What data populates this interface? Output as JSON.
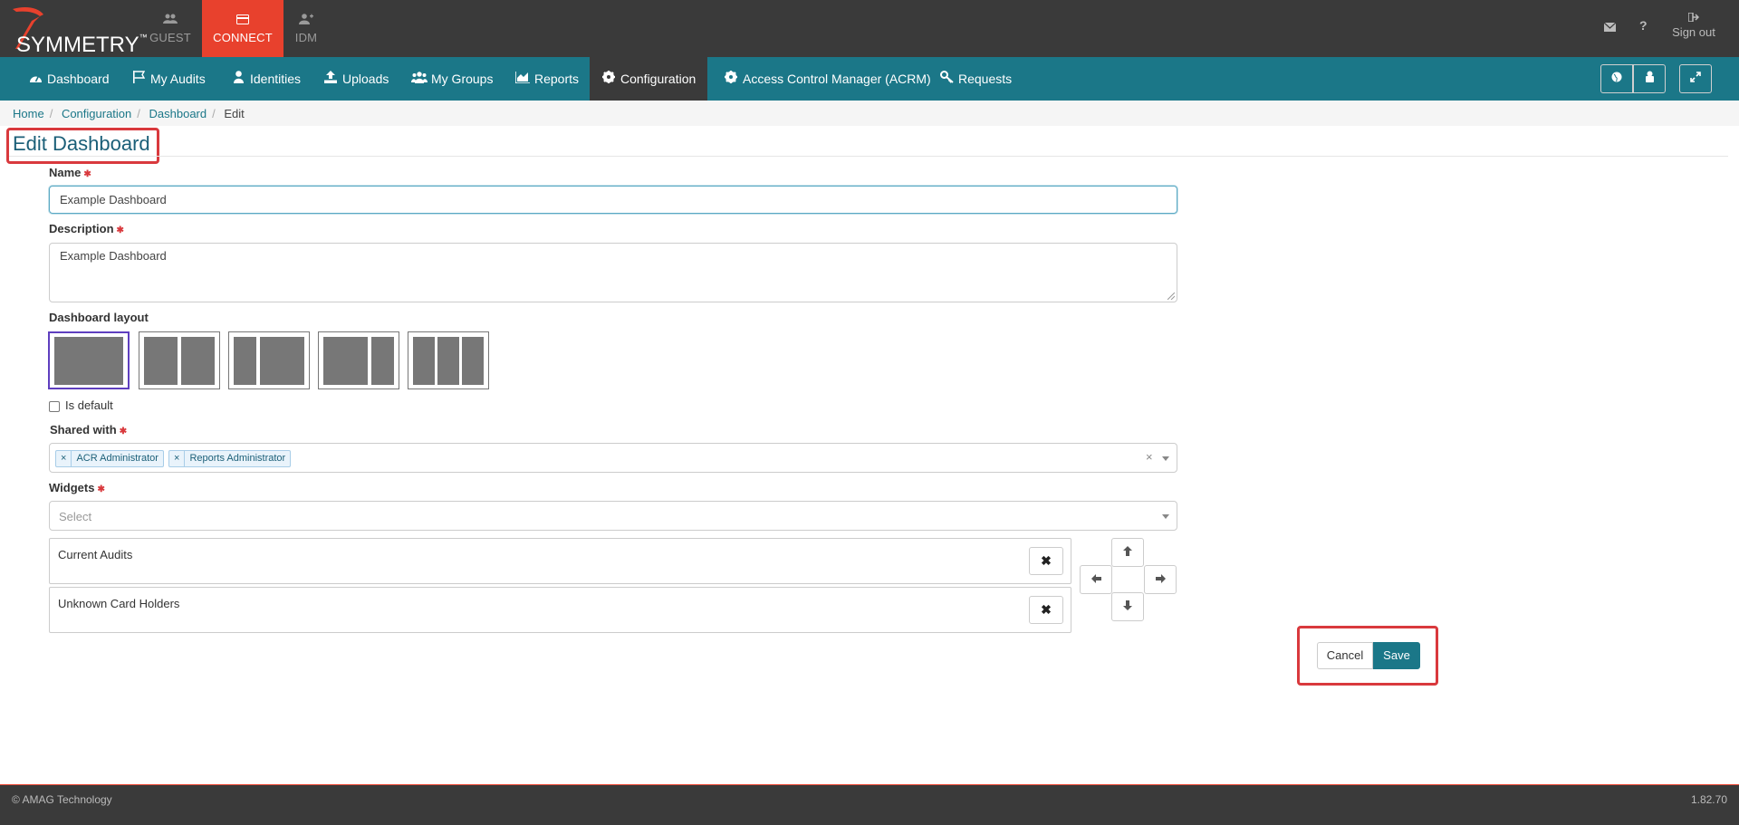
{
  "app": {
    "logo_text": "SYMMETRY",
    "logo_tm": "™",
    "tabs": [
      {
        "label": "GUEST",
        "icon": "users-icon"
      },
      {
        "label": "CONNECT",
        "icon": "card-icon"
      },
      {
        "label": "IDM",
        "icon": "user-plus-icon"
      }
    ],
    "top_right": {
      "mail_icon": "envelope-icon",
      "help_label": "?",
      "signout_label": "Sign out"
    }
  },
  "nav": {
    "items": [
      {
        "label": "Dashboard",
        "icon": "dashboard-icon"
      },
      {
        "label": "My Audits",
        "icon": "flag-icon"
      },
      {
        "label": "Identities",
        "icon": "user-icon"
      },
      {
        "label": "Uploads",
        "icon": "upload-icon"
      },
      {
        "label": "My Groups",
        "icon": "group-icon"
      },
      {
        "label": "Reports",
        "icon": "chart-icon"
      },
      {
        "label": "Configuration",
        "icon": "gear-icon"
      },
      {
        "label": "Access Control Manager (ACRM)",
        "icon": "gear-icon"
      },
      {
        "label": "Requests",
        "icon": "key-icon"
      }
    ],
    "right_buttons": [
      "globe-icon",
      "lock-icon",
      "expand-icon"
    ]
  },
  "breadcrumb": [
    "Home",
    "Configuration",
    "Dashboard",
    "Edit"
  ],
  "page_title": "Edit Dashboard",
  "form": {
    "name_label": "Name",
    "name_value": "Example Dashboard",
    "description_label": "Description",
    "description_value": "Example Dashboard",
    "layout_label": "Dashboard layout",
    "layouts_selected": 1,
    "is_default_label": "Is default",
    "is_default_checked": false,
    "shared_label": "Shared with",
    "shared_tags": [
      "ACR Administrator",
      "Reports Administrator"
    ],
    "widgets_label": "Widgets",
    "widgets_placeholder": "Select",
    "widgets": [
      "Current Audits",
      "Unknown Card Holders"
    ],
    "required_mark": "✱",
    "remove_glyph": "✖",
    "arrows": {
      "up": "🡑",
      "left": "🡐",
      "right": "🡒",
      "down": "🡓"
    }
  },
  "actions": {
    "cancel_label": "Cancel",
    "save_label": "Save"
  },
  "footer": {
    "copyright": "© AMAG Technology",
    "version": "1.82.70"
  },
  "colors": {
    "topbar": "#3a3a3a",
    "nav": "#1b7788",
    "accent_red": "#e8412d",
    "highlight": "#d9393d"
  }
}
